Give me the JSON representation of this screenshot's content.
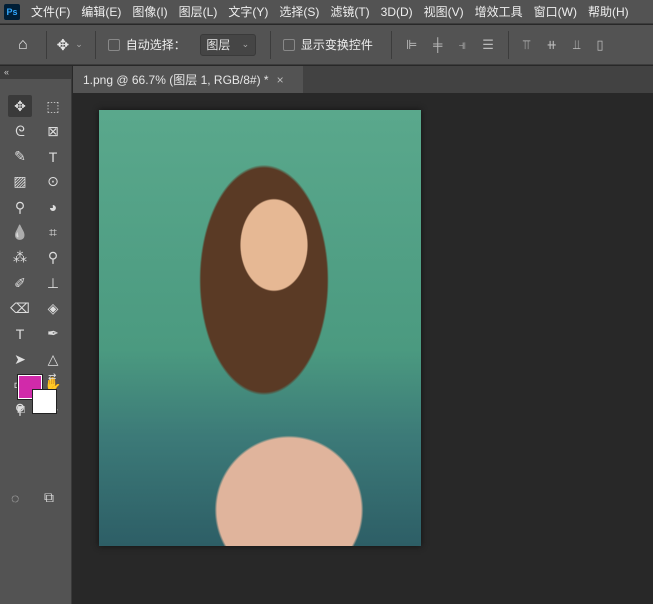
{
  "menubar": {
    "logo": "Ps",
    "items": [
      "文件(F)",
      "编辑(E)",
      "图像(I)",
      "图层(L)",
      "文字(Y)",
      "选择(S)",
      "滤镜(T)",
      "3D(D)",
      "视图(V)",
      "增效工具",
      "窗口(W)",
      "帮助(H)"
    ]
  },
  "options": {
    "auto_select_label": "自动选择：",
    "layer_select": "图层",
    "show_transform_label": "显示变换控件"
  },
  "document": {
    "tab_title": "1.png @ 66.7% (图层 1, RGB/8#) *",
    "close": "×"
  },
  "toolpanel": {
    "collapse": "«",
    "tools": [
      "move",
      "marquee",
      "lasso",
      "frame",
      "quick-select",
      "type-mask",
      "gradient",
      "red-eye",
      "eyedropper",
      "blur-shape",
      "blur",
      "crop",
      "magic-wand",
      "color-sampler",
      "brush",
      "stamp",
      "eraser",
      "paint-bucket",
      "type",
      "pen",
      "path-select",
      "triangle",
      "rectangle",
      "hand",
      "zoom",
      "more"
    ]
  },
  "colors": {
    "foreground": "#d12aaa",
    "background": "#ffffff"
  }
}
